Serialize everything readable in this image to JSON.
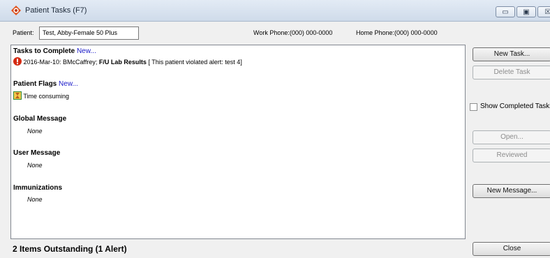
{
  "window": {
    "title": "Patient Tasks (F7)"
  },
  "patient": {
    "label": "Patient:",
    "value": "Test, Abby-Female 50 Plus",
    "work_phone": "Work Phone:(000) 000-0000",
    "home_phone": "Home Phone:(000) 000-0000"
  },
  "sections": {
    "tasks": {
      "title": "Tasks to Complete",
      "new_link": "New...",
      "item_prefix": "2016-Mar-10: BMcCaffrey; ",
      "item_bold": "F/U Lab Results",
      "item_suffix": " [ This patient violated alert: test 4]"
    },
    "flags": {
      "title": "Patient Flags",
      "new_link": "New...",
      "item": "Time consuming"
    },
    "global_message": {
      "title": "Global Message",
      "value": "None"
    },
    "user_message": {
      "title": "User Message",
      "value": "None"
    },
    "immunizations": {
      "title": "Immunizations",
      "value": "None"
    }
  },
  "buttons": {
    "new_task": "New Task...",
    "delete_task": "Delete Task",
    "show_completed": "Show Completed Tasks",
    "open": "Open...",
    "reviewed": "Reviewed",
    "new_message": "New Message...",
    "close": "Close"
  },
  "status": {
    "outstanding": "2 Items Outstanding (1 Alert)"
  },
  "colors": {
    "alert": "#d42a12",
    "link": "#1a1ac8",
    "title_bar": "#d7e2ef"
  }
}
